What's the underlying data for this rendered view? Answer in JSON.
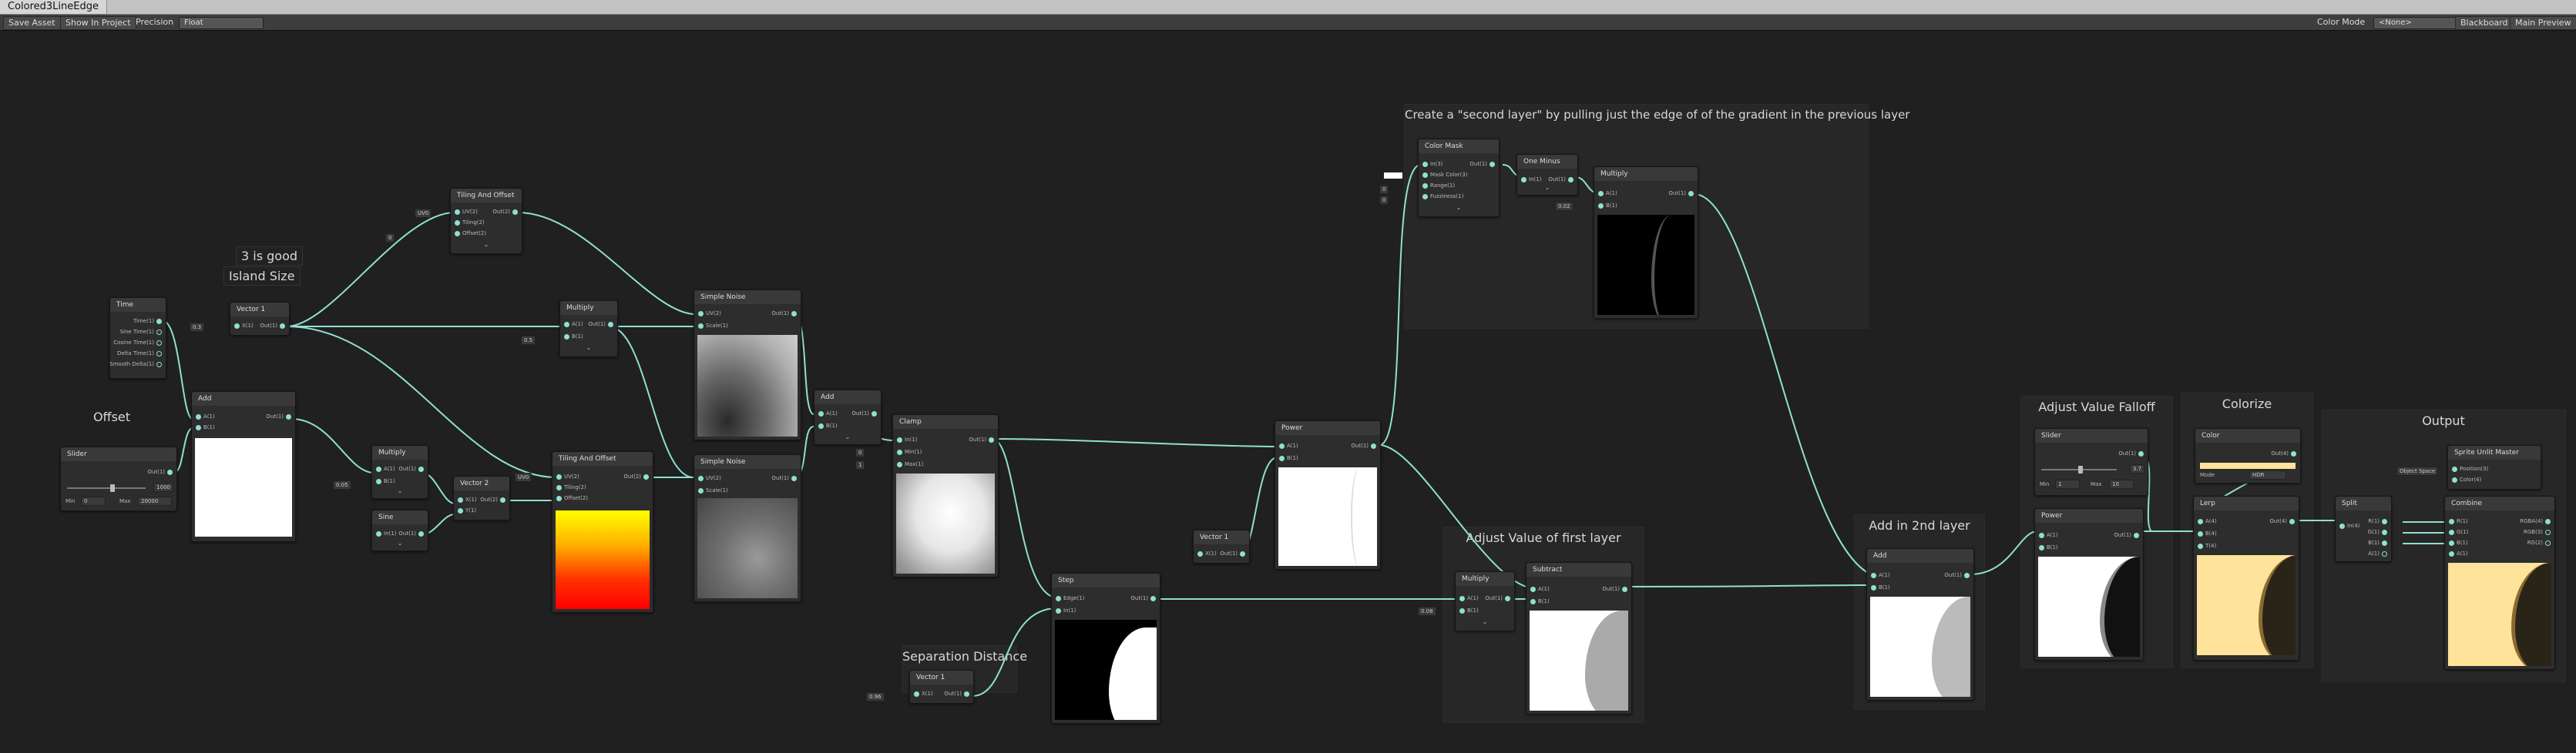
{
  "window": {
    "tab_title": "Colored3LineEdge"
  },
  "toolbar": {
    "save_asset": "Save Asset",
    "show_in_project": "Show In Project",
    "precision_label": "Precision",
    "precision_value": "Float",
    "color_mode_label": "Color Mode",
    "color_mode_value": "<None>",
    "blackboard": "Blackboard",
    "main_preview": "Main Preview"
  },
  "groups": {
    "island_size": "Island Size",
    "three_is_good": "3 is good",
    "offset": "Offset",
    "separation": "Separation Distance",
    "second_layer": "Create a \"second layer\" by pulling just the edge of of the gradient in the previous layer",
    "adjust_first": "Adjust Value of first layer",
    "add_second": "Add in 2nd layer",
    "falloff": "Adjust Value Falloff",
    "colorize": "Colorize",
    "output": "Output"
  },
  "nodes": {
    "time": {
      "title": "Time",
      "ports": [
        "Time(1)",
        "Sine Time(1)",
        "Cosine Time(1)",
        "Delta Time(1)",
        "Smooth Delta(1)"
      ]
    },
    "vector1_island": {
      "title": "Vector 1",
      "in": "X(1)",
      "out": "Out(1)",
      "value": "0.3"
    },
    "tiling_top": {
      "title": "Tiling And Offset",
      "ports": [
        "UV(2)",
        "Tiling(2)",
        "Offset(2)"
      ],
      "out": "Out(2)",
      "uv": "UV0",
      "tiling": "0"
    },
    "multiply_mid": {
      "title": "Multiply",
      "ports": [
        "A(1)",
        "B(1)"
      ],
      "out": "Out(1)",
      "b": "0.5"
    },
    "simple_noise_1": {
      "title": "Simple Noise",
      "ports": [
        "UV(2)",
        "Scale(1)"
      ],
      "out": "Out(1)"
    },
    "simple_noise_2": {
      "title": "Simple Noise",
      "ports": [
        "UV(2)",
        "Scale(1)"
      ],
      "out": "Out(1)"
    },
    "add_left": {
      "title": "Add",
      "ports": [
        "A(1)",
        "B(1)"
      ],
      "out": "Out(1)"
    },
    "slider": {
      "title": "Slider",
      "out": "Out(1)",
      "min_label": "Min",
      "min": "0",
      "max_label": "Max",
      "max": "20000",
      "value": "1000"
    },
    "multiply_left": {
      "title": "Multiply",
      "ports": [
        "A(1)",
        "B(1)"
      ],
      "out": "Out(1)",
      "a": "0.05"
    },
    "sine": {
      "title": "Sine",
      "ports": [
        "In(1)"
      ],
      "out": "Out(1)"
    },
    "vector2": {
      "title": "Vector 2",
      "ports": [
        "X(1)",
        "Y(1)"
      ],
      "out": "Out(2)"
    },
    "tiling_bottom": {
      "title": "Tiling And Offset",
      "ports": [
        "UV(2)",
        "Tiling(2)",
        "Offset(2)"
      ],
      "out": "Out(2)",
      "uv": "UV0"
    },
    "add_mid": {
      "title": "Add",
      "ports": [
        "A(1)",
        "B(1)"
      ],
      "out": "Out(1)"
    },
    "clamp": {
      "title": "Clamp",
      "ports": [
        "In(1)",
        "Min(1)",
        "Max(1)"
      ],
      "out": "Out(1)",
      "min": "0",
      "max": "1"
    },
    "step": {
      "title": "Step",
      "ports": [
        "Edge(1)",
        "In(1)"
      ],
      "out": "Out(1)"
    },
    "vector1_sep": {
      "title": "Vector 1",
      "in": "X(1)",
      "out": "Out(1)",
      "value": "0.96"
    },
    "vector1_mid": {
      "title": "Vector 1",
      "in": "X(1)",
      "out": "Out(1)"
    },
    "power_mid": {
      "title": "Power",
      "ports": [
        "A(1)",
        "B(1)"
      ],
      "out": "Out(1)"
    },
    "color_mask": {
      "title": "Color Mask",
      "ports": [
        "In(3)",
        "Mask Color(3)",
        "Range(1)",
        "Fuzziness(1)"
      ],
      "out": "Out(1)",
      "range": "0",
      "fuzz": "0"
    },
    "one_minus": {
      "title": "One Minus",
      "ports": [
        "In(1)"
      ],
      "out": "Out(1)"
    },
    "multiply_top": {
      "title": "Multiply",
      "ports": [
        "A(1)",
        "B(1)"
      ],
      "out": "Out(1)",
      "b": "0.02"
    },
    "multiply_adj": {
      "title": "Multiply",
      "ports": [
        "A(1)",
        "B(1)"
      ],
      "out": "Out(1)",
      "b": "0.08"
    },
    "subtract": {
      "title": "Subtract",
      "ports": [
        "A(1)",
        "B(1)"
      ],
      "out": "Out(1)"
    },
    "add_second": {
      "title": "Add",
      "ports": [
        "A(1)",
        "B(1)"
      ],
      "out": "Out(1)"
    },
    "slider_falloff": {
      "title": "Slider",
      "out": "Out(1)",
      "min_label": "Min",
      "min": "1",
      "max_label": "Max",
      "max": "10",
      "value": "3.7"
    },
    "power_falloff": {
      "title": "Power",
      "ports": [
        "A(1)",
        "B(1)"
      ],
      "out": "Out(1)"
    },
    "color": {
      "title": "Color",
      "out": "Out(4)",
      "mode_label": "Mode",
      "mode_value": "HDR"
    },
    "lerp": {
      "title": "Lerp",
      "ports": [
        "A(4)",
        "B(4)",
        "T(4)"
      ],
      "out": "Out(4)"
    },
    "split": {
      "title": "Split",
      "ports": [
        "In(4)"
      ],
      "outs": [
        "R(1)",
        "G(1)",
        "B(1)",
        "A(1)"
      ]
    },
    "sprite_master": {
      "title": "Sprite Unlit Master",
      "ports": [
        "Position(3)",
        "Color(4)"
      ],
      "space": "Object Space"
    },
    "combine": {
      "title": "Combine",
      "ports": [
        "R(1)",
        "G(1)",
        "B(1)",
        "A(1)"
      ],
      "outs": [
        "RGBA(4)",
        "RGB(3)",
        "RG(2)"
      ]
    }
  },
  "colors": {
    "wire": "#8fe0d0",
    "canvas": "#202020",
    "node": "#2d2d2d",
    "header": "#393939",
    "group": "#282828",
    "colorize": "#ffe39a"
  }
}
